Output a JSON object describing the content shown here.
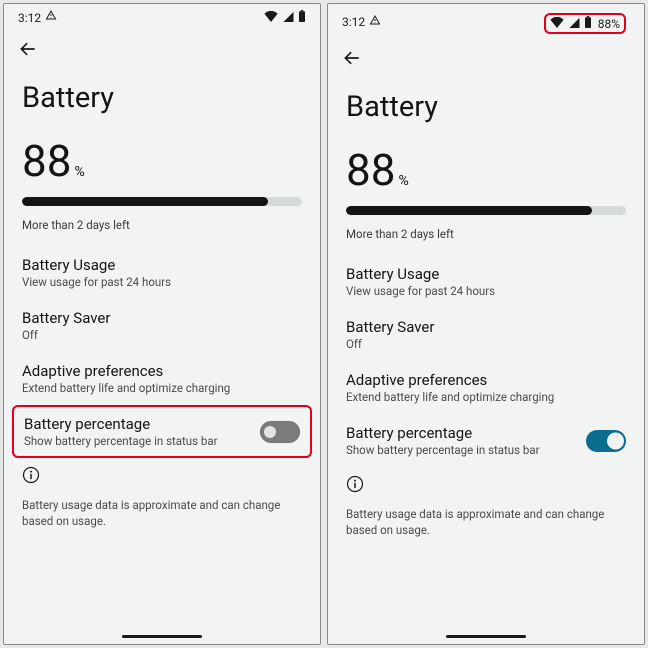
{
  "left": {
    "status": {
      "time": "3:12",
      "percent_text": "",
      "show_percent": false
    },
    "title": "Battery",
    "battery": {
      "value": "88",
      "unit": "%",
      "fill": 88
    },
    "estimate": "More than 2 days left",
    "items": {
      "usage": {
        "title": "Battery Usage",
        "sub": "View usage for past 24 hours"
      },
      "saver": {
        "title": "Battery Saver",
        "sub": "Off"
      },
      "adaptive": {
        "title": "Adaptive preferences",
        "sub": "Extend battery life and optimize charging"
      },
      "percent": {
        "title": "Battery percentage",
        "sub": "Show battery percentage in status bar",
        "on": false
      }
    },
    "footnote": "Battery usage data is approximate and can change based on usage."
  },
  "right": {
    "status": {
      "time": "3:12",
      "percent_text": "88%",
      "show_percent": true
    },
    "title": "Battery",
    "battery": {
      "value": "88",
      "unit": "%",
      "fill": 88
    },
    "estimate": "More than 2 days left",
    "items": {
      "usage": {
        "title": "Battery Usage",
        "sub": "View usage for past 24 hours"
      },
      "saver": {
        "title": "Battery Saver",
        "sub": "Off"
      },
      "adaptive": {
        "title": "Adaptive preferences",
        "sub": "Extend battery life and optimize charging"
      },
      "percent": {
        "title": "Battery percentage",
        "sub": "Show battery percentage in status bar",
        "on": true
      }
    },
    "footnote": "Battery usage data is approximate and can change based on usage."
  }
}
